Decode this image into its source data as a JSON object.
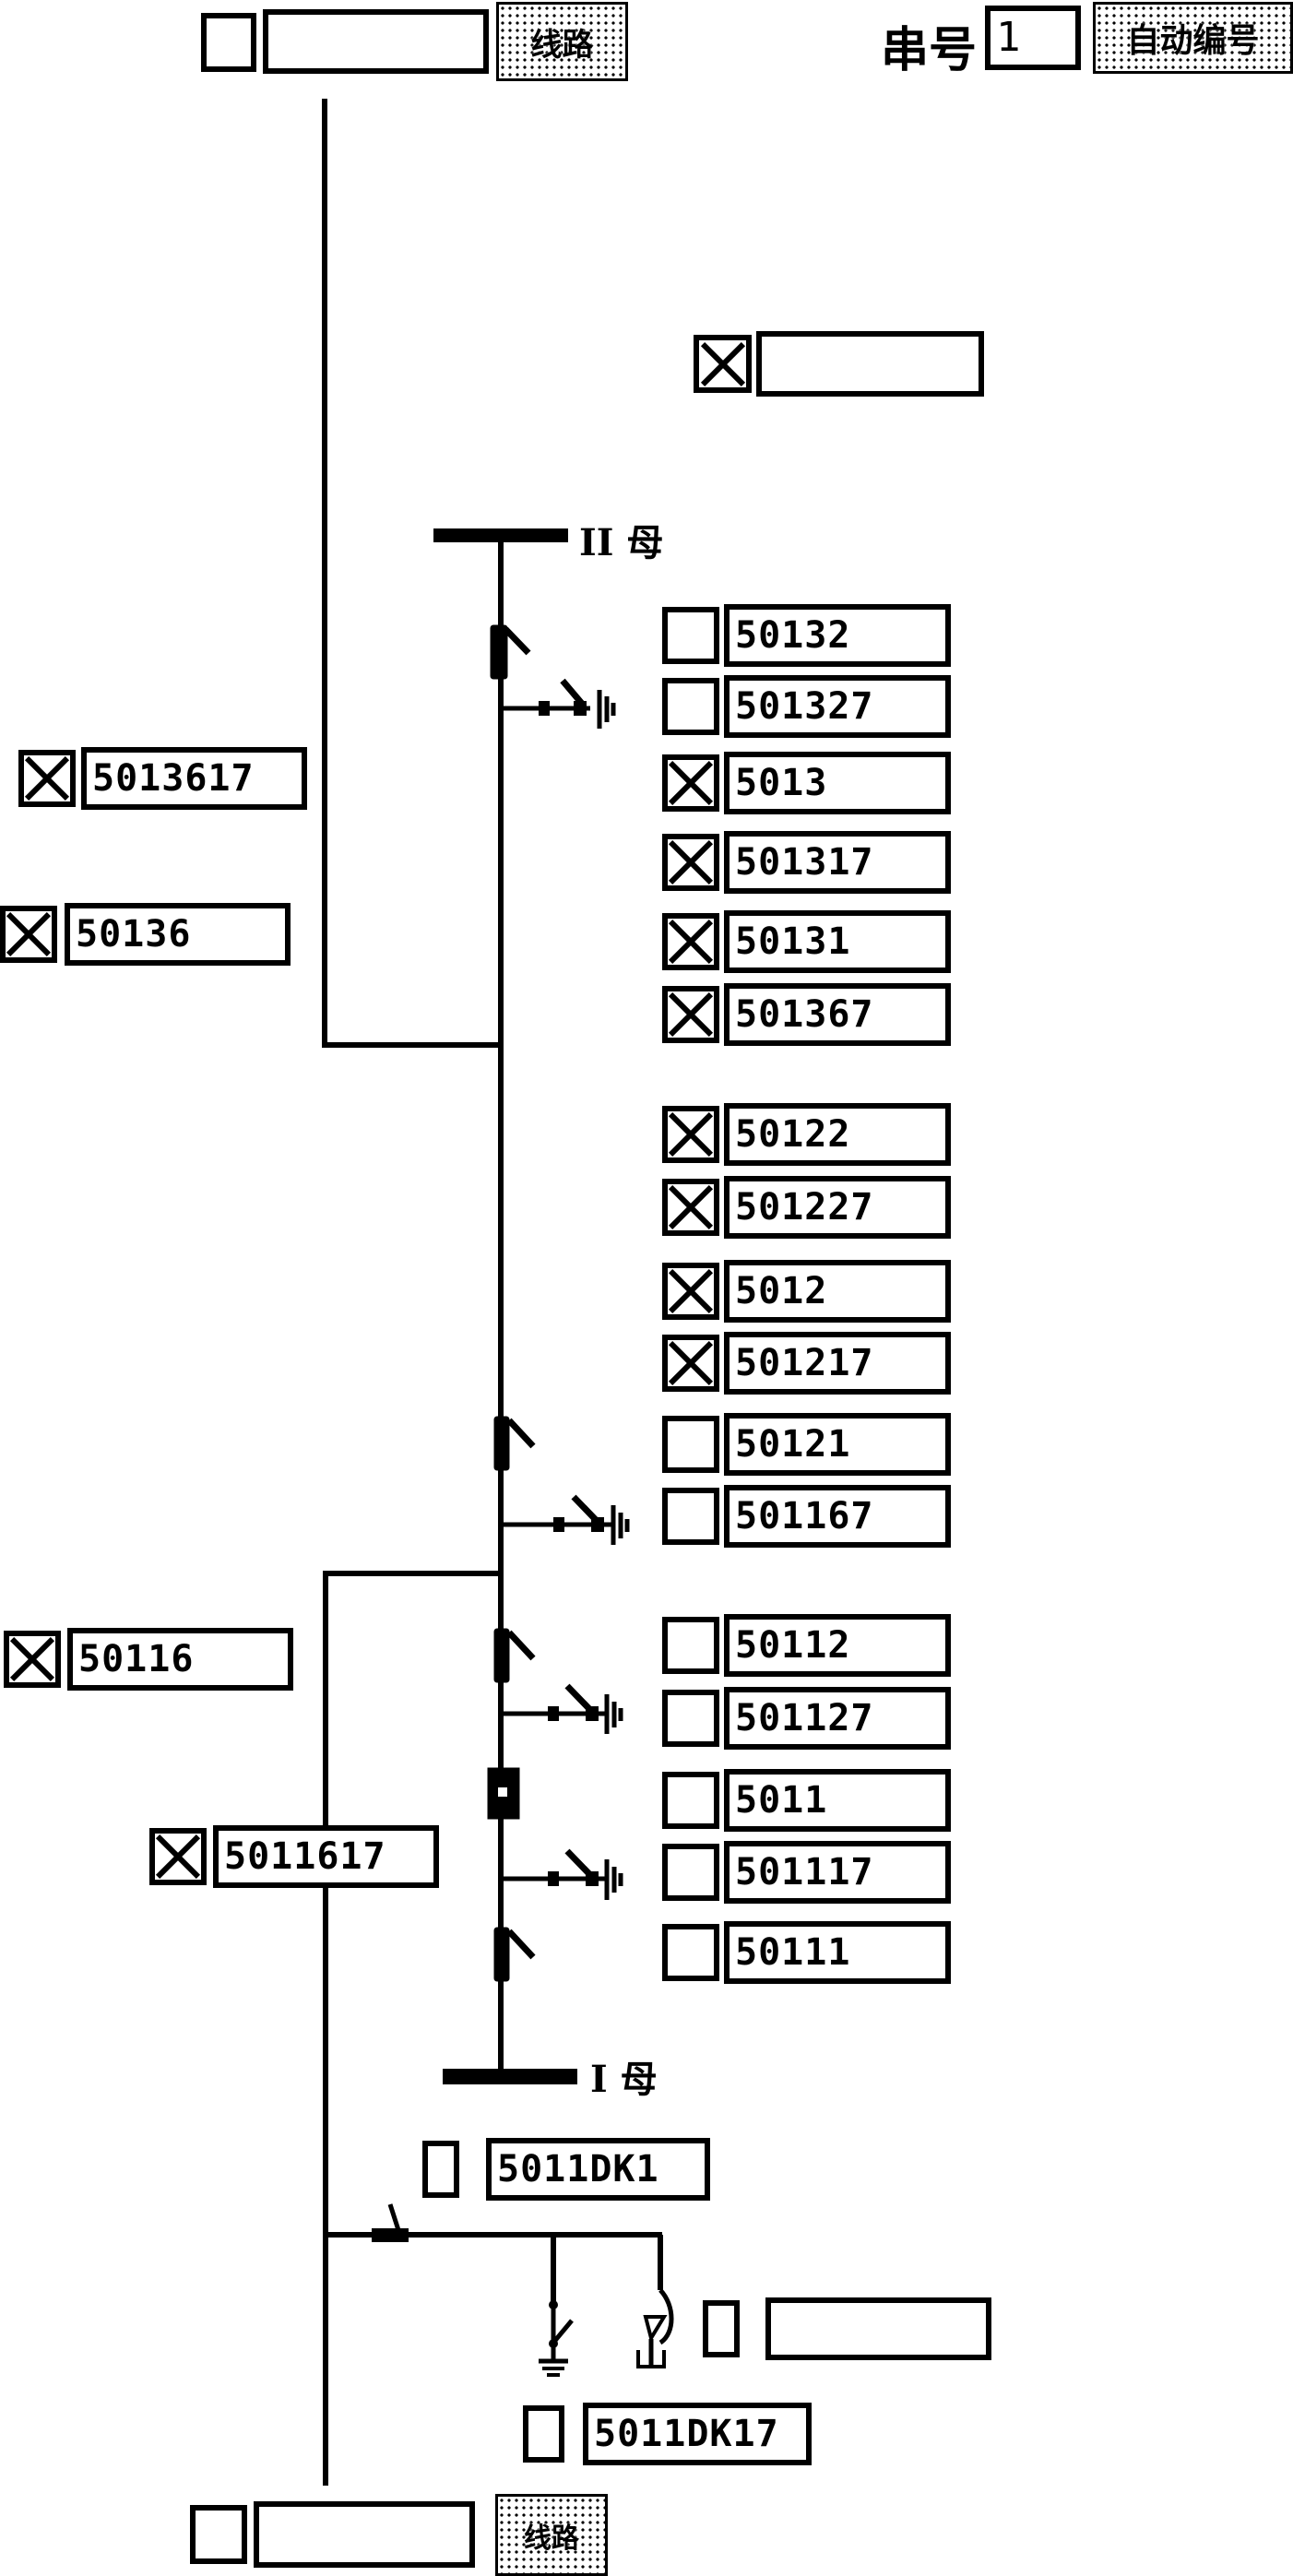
{
  "header": {
    "serial_label": "串号",
    "serial_value": "1",
    "auto_number_button": "自动编号",
    "top_line_button": "线路",
    "top_line_field": "",
    "top_line_checked": false
  },
  "footer": {
    "bottom_line_button": "线路",
    "bottom_line_field": "",
    "bottom_line_checked": false
  },
  "bus": {
    "upper_label": "II 母",
    "lower_label": "I 母"
  },
  "floating_item": {
    "checked": true,
    "value": ""
  },
  "right_items": [
    {
      "id": "50132",
      "checked": false
    },
    {
      "id": "501327",
      "checked": false
    },
    {
      "id": "5013",
      "checked": true
    },
    {
      "id": "501317",
      "checked": true
    },
    {
      "id": "50131",
      "checked": true
    },
    {
      "id": "501367",
      "checked": true
    },
    {
      "id": "50122",
      "checked": true
    },
    {
      "id": "501227",
      "checked": true
    },
    {
      "id": "5012",
      "checked": true
    },
    {
      "id": "501217",
      "checked": true
    },
    {
      "id": "50121",
      "checked": false
    },
    {
      "id": "501167",
      "checked": false
    },
    {
      "id": "50112",
      "checked": false
    },
    {
      "id": "501127",
      "checked": false
    },
    {
      "id": "5011",
      "checked": false
    },
    {
      "id": "501117",
      "checked": false
    },
    {
      "id": "50111",
      "checked": false
    }
  ],
  "left_items": [
    {
      "id": "5013617",
      "checked": true
    },
    {
      "id": "50136",
      "checked": true
    },
    {
      "id": "50116",
      "checked": true
    },
    {
      "id": "5011617",
      "checked": true
    }
  ],
  "reactor_items": [
    {
      "id": "5011DK1",
      "checked": false
    },
    {
      "id": "",
      "checked": false
    },
    {
      "id": "5011DK17",
      "checked": false
    }
  ],
  "colors": {
    "line": "#000000",
    "background": "#ffffff"
  }
}
